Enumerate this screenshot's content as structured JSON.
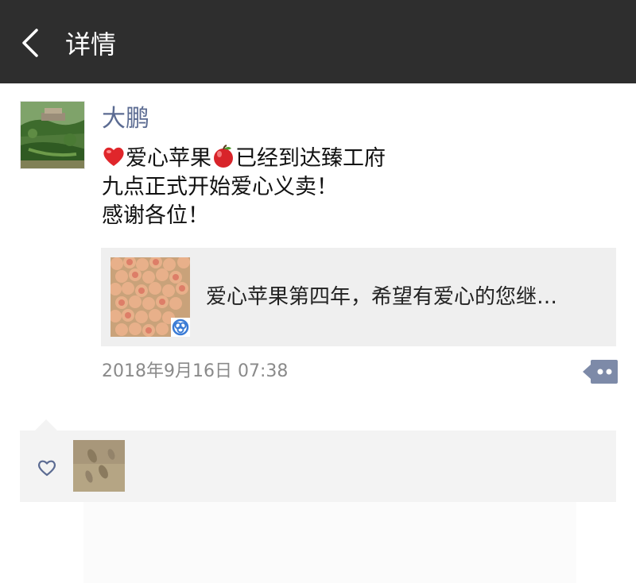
{
  "header": {
    "back_icon": "chevron-left-icon",
    "title": "详情"
  },
  "post": {
    "author": "大鹏",
    "lines": [
      {
        "before": "",
        "icon": "red-heart-icon",
        "text1": "爱心苹果",
        "icon2": "red-apple-icon",
        "text2": "已经到达臻工府"
      },
      {
        "text": "九点正式开始爱心义卖！"
      },
      {
        "text": "感谢各位！"
      }
    ],
    "link_card": {
      "title": "爱心苹果第四年，希望有爱心的您继…",
      "badge_icon": "mini-program-icon"
    },
    "timestamp": "2018年9月16日 07:38",
    "comment_icon": "more-dots-icon"
  },
  "likes": {
    "heart_icon": "heart-outline-icon",
    "count_avatars": 1
  },
  "colors": {
    "topbar": "#2e2e2e",
    "author_name": "#5b6b92",
    "panel_bg": "#f3f3f3",
    "comment_button": "#7d8aa8"
  }
}
